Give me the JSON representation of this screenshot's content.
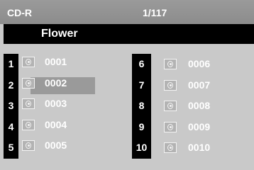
{
  "header": {
    "disc_type": "CD-R",
    "track_counter": "1/117"
  },
  "folder": {
    "name": "Flower"
  },
  "files": [
    {
      "num": "1",
      "name": "0001",
      "selected": false
    },
    {
      "num": "2",
      "name": "0002",
      "selected": true
    },
    {
      "num": "3",
      "name": "0003",
      "selected": false
    },
    {
      "num": "4",
      "name": "0004",
      "selected": false
    },
    {
      "num": "5",
      "name": "0005",
      "selected": false
    },
    {
      "num": "6",
      "name": "0006",
      "selected": false
    },
    {
      "num": "7",
      "name": "0007",
      "selected": false
    },
    {
      "num": "8",
      "name": "0008",
      "selected": false
    },
    {
      "num": "9",
      "name": "0009",
      "selected": false
    },
    {
      "num": "10",
      "name": "0010",
      "selected": false
    }
  ],
  "icons": {
    "file": "photo-file-icon"
  }
}
